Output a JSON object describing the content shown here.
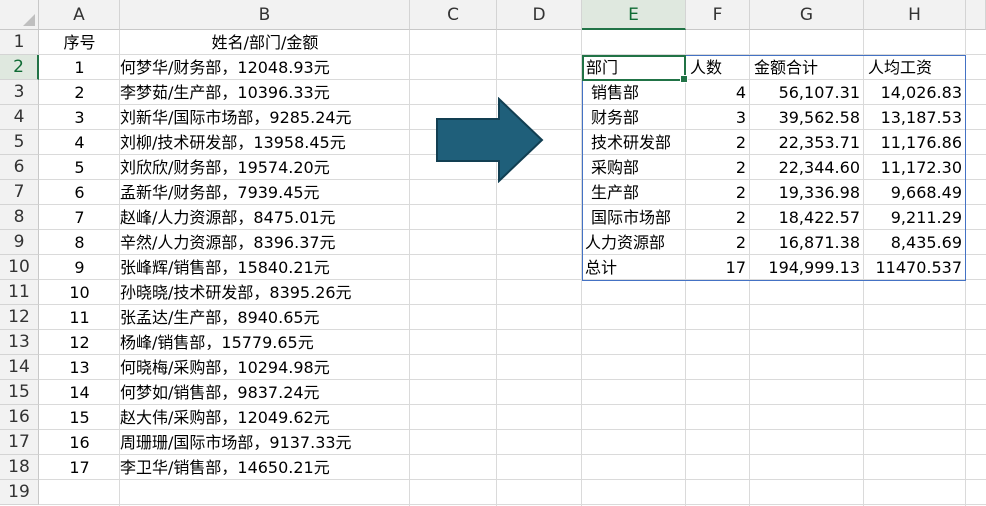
{
  "columns": [
    "A",
    "B",
    "C",
    "D",
    "E",
    "F",
    "G",
    "H"
  ],
  "selected_column": "E",
  "rows": [
    "1",
    "2",
    "3",
    "4",
    "5",
    "6",
    "7",
    "8",
    "9",
    "10",
    "11",
    "12",
    "13",
    "14",
    "15",
    "16",
    "17",
    "18",
    "19"
  ],
  "selected_row": "2",
  "headers": {
    "seq": "序号",
    "name_dept_amount": "姓名/部门/金额"
  },
  "source": [
    {
      "seq": "1",
      "text": "何梦华/财务部，12048.93元"
    },
    {
      "seq": "2",
      "text": "李梦茹/生产部，10396.33元"
    },
    {
      "seq": "3",
      "text": "刘新华/国际市场部，9285.24元"
    },
    {
      "seq": "4",
      "text": "刘柳/技术研发部，13958.45元"
    },
    {
      "seq": "5",
      "text": "刘欣欣/财务部，19574.20元"
    },
    {
      "seq": "6",
      "text": "孟新华/财务部，7939.45元"
    },
    {
      "seq": "7",
      "text": "赵峰/人力资源部，8475.01元"
    },
    {
      "seq": "8",
      "text": "辛然/人力资源部，8396.37元"
    },
    {
      "seq": "9",
      "text": "张峰辉/销售部，15840.21元"
    },
    {
      "seq": "10",
      "text": "孙晓晓/技术研发部，8395.26元"
    },
    {
      "seq": "11",
      "text": "张孟达/生产部，8940.65元"
    },
    {
      "seq": "12",
      "text": "杨峰/销售部，15779.65元"
    },
    {
      "seq": "13",
      "text": "何晓梅/采购部，10294.98元"
    },
    {
      "seq": "14",
      "text": "何梦如/销售部，9837.24元"
    },
    {
      "seq": "15",
      "text": "赵大伟/采购部，12049.62元"
    },
    {
      "seq": "16",
      "text": "周珊珊/国际市场部，9137.33元"
    },
    {
      "seq": "17",
      "text": "李卫华/销售部，14650.21元"
    }
  ],
  "pivot": {
    "headers": [
      "部门",
      "人数",
      "金额合计",
      "人均工资"
    ],
    "rows": [
      [
        "销售部",
        "4",
        "56,107.31",
        "14,026.83"
      ],
      [
        "财务部",
        "3",
        "39,562.58",
        "13,187.53"
      ],
      [
        "技术研发部",
        "2",
        "22,353.71",
        "11,176.86"
      ],
      [
        "采购部",
        "2",
        "22,344.60",
        "11,172.30"
      ],
      [
        "生产部",
        "2",
        "19,336.98",
        "9,668.49"
      ],
      [
        "国际市场部",
        "2",
        "18,422.57",
        "9,211.29"
      ],
      [
        "人力资源部",
        "2",
        "16,871.38",
        "8,435.69"
      ]
    ],
    "total": [
      "总计",
      "17",
      "194,999.13",
      "11470.537"
    ]
  },
  "colors": {
    "arrow_fill": "#1f5f7a",
    "arrow_stroke": "#123f52",
    "selection": "#217346",
    "pivot_border": "#4472c4"
  }
}
